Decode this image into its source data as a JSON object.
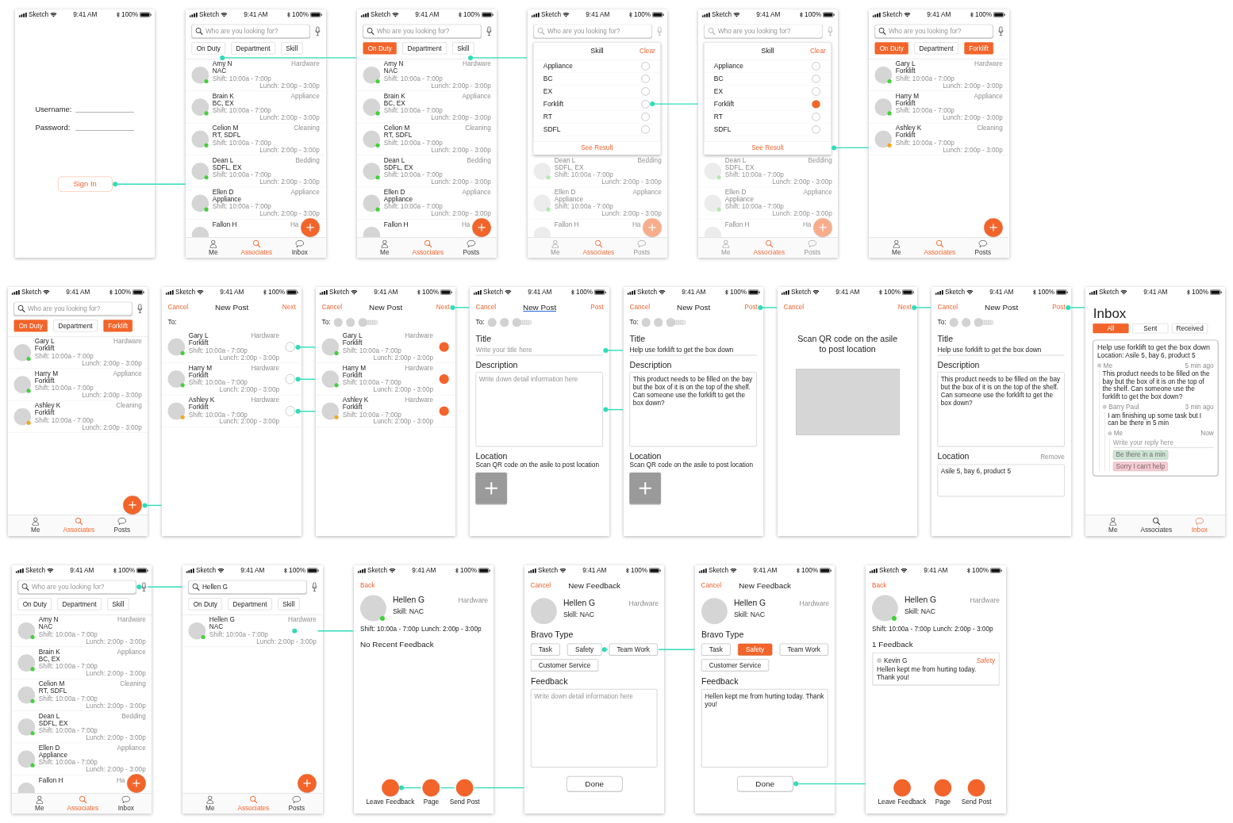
{
  "rows": [
    {
      "screens": [
        {
          "kind": "login",
          "status_bar": {
            "carrier": "Sketch",
            "time": "9:41 AM",
            "battery": "100%"
          },
          "fields": [
            {
              "label": "Username:"
            },
            {
              "label": "Password:"
            }
          ],
          "button": {
            "label": "Sign In",
            "link": true
          }
        },
        {
          "kind": "directory",
          "status_bar": {
            "carrier": "Sketch",
            "time": "9:41 AM",
            "battery": "100%"
          },
          "search": {
            "placeholder": "Who are you looking for?"
          },
          "chips": [
            {
              "label": "On Duty",
              "selected": false,
              "link": true
            },
            {
              "label": "Department",
              "selected": false,
              "link": false
            },
            {
              "label": "Skill",
              "selected": false,
              "link": false
            }
          ],
          "rows": [
            {
              "name": "Amy N",
              "skills": "NAC",
              "department": "Hardware",
              "shift": "Shift: 10:00a - 7:00p",
              "lunch": "Lunch: 2:00p - 3:00p",
              "color": "#43d13b"
            },
            {
              "name": "Brain K",
              "skills": "BC, EX",
              "department": "Appliance",
              "shift": "Shift: 10:00a - 7:00p",
              "lunch": "Lunch: 2:00p - 3:00p",
              "color": "#43d13b"
            },
            {
              "name": "Celion M",
              "skills": "RT, SDFL",
              "department": "Cleaning",
              "shift": "Shift: 10:00a - 7:00p",
              "lunch": "Lunch: 2:00p - 3:00p",
              "color": "#43d13b"
            },
            {
              "name": "Dean L",
              "skills": "SDFL, EX",
              "department": "Bedding",
              "shift": "Shift: 10:00a - 7:00p",
              "lunch": "Lunch: 2:00p - 3:00p",
              "color": "#43d13b"
            },
            {
              "name": "Ellen D",
              "skills": "Appliance",
              "department": "Appliance",
              "shift": "Shift: 10:00a - 7:00p",
              "lunch": "Lunch: 2:00p - 3:00p",
              "color": "#43d13b"
            },
            {
              "name": "Fallon H",
              "department": "Ha"
            }
          ],
          "fab": {
            "link": false
          },
          "tabs": [
            {
              "label": "Me",
              "selected": false
            },
            {
              "label": "Associates",
              "selected": true
            },
            {
              "label": "Inbox",
              "selected": false
            }
          ]
        },
        {
          "kind": "directory",
          "status_bar": {
            "carrier": "Sketch",
            "time": "9:41 AM",
            "battery": "100%"
          },
          "search": {
            "placeholder": "Who are you looking for?"
          },
          "chips": [
            {
              "label": "On Duty",
              "selected": true,
              "link": false
            },
            {
              "label": "Department",
              "selected": false,
              "link": false
            },
            {
              "label": "Skill",
              "selected": false,
              "link": true
            }
          ],
          "rows": [
            {
              "name": "Amy N",
              "skills": "NAC",
              "department": "Hardware",
              "shift": "Shift: 10:00a - 7:00p",
              "lunch": "Lunch: 2:00p - 3:00p",
              "color": "#43d13b"
            },
            {
              "name": "Brain K",
              "skills": "BC, EX",
              "department": "Appliance",
              "shift": "Shift: 10:00a - 7:00p",
              "lunch": "Lunch: 2:00p - 3:00p",
              "color": "#43d13b"
            },
            {
              "name": "Celion M",
              "skills": "RT, SDFL",
              "department": "Cleaning",
              "shift": "Shift: 10:00a - 7:00p",
              "lunch": "Lunch: 2:00p - 3:00p",
              "color": "#43d13b"
            },
            {
              "name": "Dean L",
              "skills": "SDFL, EX",
              "department": "Bedding",
              "shift": "Shift: 10:00a - 7:00p",
              "lunch": "Lunch: 2:00p - 3:00p",
              "color": "#43d13b"
            },
            {
              "name": "Ellen D",
              "skills": "Appliance",
              "department": "Appliance",
              "shift": "Shift: 10:00a - 7:00p",
              "lunch": "Lunch: 2:00p - 3:00p",
              "color": "#43d13b"
            },
            {
              "name": "Fallon H",
              "department": "Ha"
            }
          ],
          "fab": {
            "link": false
          },
          "tabs": [
            {
              "label": "Me",
              "selected": false
            },
            {
              "label": "Associates",
              "selected": true
            },
            {
              "label": "Posts",
              "selected": false
            }
          ]
        },
        {
          "kind": "skill_filter",
          "status_bar": {
            "carrier": "Sketch",
            "time": "9:41 AM",
            "battery": "100%"
          },
          "search": {
            "placeholder": "Who are you looking for?"
          },
          "popup": {
            "title": "Skill",
            "clear": "Clear",
            "options": [
              {
                "label": "Appliance",
                "selected": false,
                "link": false
              },
              {
                "label": "BC",
                "selected": false,
                "link": false
              },
              {
                "label": "EX",
                "selected": false,
                "link": false
              },
              {
                "label": "Forklift",
                "selected": false,
                "link": true
              },
              {
                "label": "RT",
                "selected": false,
                "link": false
              },
              {
                "label": "SDFL",
                "selected": false,
                "link": false
              }
            ],
            "button": {
              "label": "See Result",
              "link": false
            }
          },
          "rows": [
            {
              "name": "Dean L",
              "skills": "SDFL, EX",
              "department": "Bedding",
              "shift": "Shift: 10:00a - 7:00p",
              "lunch": "Lunch: 2:00p - 3:00p",
              "color": "#b2e9ad"
            },
            {
              "name": "Ellen D",
              "skills": "Appliance",
              "department": "Appliance",
              "shift": "Shift: 10:00a - 7:00p",
              "lunch": "Lunch: 2:00p - 3:00p",
              "color": "#b2e9ad"
            },
            {
              "name": "Fallon H",
              "department": "Ha"
            }
          ],
          "fab": {
            "link": false
          },
          "tabs": [
            {
              "label": "Me",
              "selected": false
            },
            {
              "label": "Associates",
              "selected": true
            },
            {
              "label": "Posts",
              "selected": false
            }
          ]
        },
        {
          "kind": "skill_filter",
          "status_bar": {
            "carrier": "Sketch",
            "time": "9:41 AM",
            "battery": "100%"
          },
          "search": {
            "placeholder": "Who are you looking for?"
          },
          "popup": {
            "title": "Skill",
            "clear": "Clear",
            "options": [
              {
                "label": "Appliance",
                "selected": false,
                "link": false
              },
              {
                "label": "BC",
                "selected": false,
                "link": false
              },
              {
                "label": "EX",
                "selected": false,
                "link": false
              },
              {
                "label": "Forklift",
                "selected": true,
                "link": false
              },
              {
                "label": "RT",
                "selected": false,
                "link": false
              },
              {
                "label": "SDFL",
                "selected": false,
                "link": false
              }
            ],
            "button": {
              "label": "See Result",
              "link": true
            }
          },
          "rows": [
            {
              "name": "Dean L",
              "skills": "SDFL, EX",
              "department": "Bedding",
              "shift": "Shift: 10:00a - 7:00p",
              "lunch": "Lunch: 2:00p - 3:00p",
              "color": "#b2e9ad"
            },
            {
              "name": "Ellen D",
              "skills": "Appliance",
              "department": "Appliance",
              "shift": "Shift: 10:00a - 7:00p",
              "lunch": "Lunch: 2:00p - 3:00p",
              "color": "#b2e9ad"
            },
            {
              "name": "Fallon H",
              "department": "Ha"
            }
          ],
          "fab": {
            "link": false
          },
          "tabs": [
            {
              "label": "Me",
              "selected": false
            },
            {
              "label": "Associates",
              "selected": true
            },
            {
              "label": "Posts",
              "selected": false
            }
          ]
        },
        {
          "kind": "directory",
          "status_bar": {
            "carrier": "Sketch",
            "time": "9:41 AM",
            "battery": "100%"
          },
          "search": {
            "placeholder": "Who are you looking for?"
          },
          "chips": [
            {
              "label": "On Duty",
              "selected": true
            },
            {
              "label": "Department",
              "selected": false
            },
            {
              "label": "Forklift",
              "selected": true
            }
          ],
          "rows": [
            {
              "name": "Gary L",
              "skills": "Forklift",
              "department": "Hardware",
              "shift": "Shift: 10:00a - 7:00p",
              "lunch": "Lunch: 2:00p - 3:00p",
              "color": "#43d13b"
            },
            {
              "name": "Harry M",
              "skills": "Forklift",
              "department": "Appliance",
              "shift": "Shift: 10:00a - 7:00p",
              "lunch": "Lunch: 2:00p - 3:00p",
              "color": "#43d13b"
            },
            {
              "name": "Ashley K",
              "skills": "Forklift",
              "department": "Cleaning",
              "shift": "Shift: 10:00a - 7:00p",
              "lunch": "Lunch: 2:00p - 3:00p",
              "color": "#f5a623"
            }
          ],
          "fab": {
            "link": false
          },
          "tabs": [
            {
              "label": "Me",
              "selected": false
            },
            {
              "label": "Associates",
              "selected": true
            },
            {
              "label": "Posts",
              "selected": false
            }
          ]
        }
      ]
    },
    {
      "screens": [
        {
          "kind": "directory",
          "status_bar": {
            "carrier": "Sketch",
            "time": "9:41 AM",
            "battery": "100%"
          },
          "search": {
            "placeholder": "Who are you looking for?"
          },
          "chips": [
            {
              "label": "On Duty",
              "selected": true
            },
            {
              "label": "Department",
              "selected": false
            },
            {
              "label": "Forklift",
              "selected": true
            }
          ],
          "rows": [
            {
              "name": "Gary L",
              "skills": "Forklift",
              "department": "Hardware",
              "shift": "Shift: 10:00a - 7:00p",
              "lunch": "Lunch: 2:00p - 3:00p",
              "color": "#43d13b"
            },
            {
              "name": "Harry M",
              "skills": "Forklift",
              "department": "Appliance",
              "shift": "Shift: 10:00a - 7:00p",
              "lunch": "Lunch: 2:00p - 3:00p",
              "color": "#43d13b"
            },
            {
              "name": "Ashley K",
              "skills": "Forklift",
              "department": "Cleaning",
              "shift": "Shift: 10:00a - 7:00p",
              "lunch": "Lunch: 2:00p - 3:00p",
              "color": "#f5a623"
            }
          ],
          "fab": {
            "link": true
          },
          "tabs": [
            {
              "label": "Me",
              "selected": false
            },
            {
              "label": "Associates",
              "selected": true
            },
            {
              "label": "Posts",
              "selected": false
            }
          ]
        },
        {
          "kind": "pick_recipients",
          "status_bar": {
            "carrier": "Sketch",
            "time": "9:41 AM",
            "battery": "100%"
          },
          "nav": {
            "left": "Cancel",
            "title": "New Post",
            "right": "Next",
            "right_link": false
          },
          "to": {
            "label": "To:"
          },
          "rows": [
            {
              "name": "Gary L",
              "skills": "Forklift",
              "department": "Hardware",
              "shift": "Shift: 10:00a - 7:00p",
              "lunch": "Lunch: 2:00p - 3:00p",
              "color": "#43d13b",
              "selected": false,
              "link": true
            },
            {
              "name": "Harry M",
              "skills": "Forklift",
              "department": "Hardware",
              "shift": "Shift: 10:00a - 7:00p",
              "lunch": "Lunch: 2:00p - 3:00p",
              "color": "#43d13b",
              "selected": false,
              "link": true
            },
            {
              "name": "Ashley K",
              "skills": "Forklift",
              "department": "Hardware",
              "shift": "Shift: 10:00a - 7:00p",
              "lunch": "Lunch: 2:00p - 3:00p",
              "color": "#f5a623",
              "selected": false,
              "link": true
            }
          ]
        },
        {
          "kind": "pick_recipients",
          "status_bar": {
            "carrier": "Sketch",
            "time": "9:41 AM",
            "battery": "100%"
          },
          "nav": {
            "left": "Cancel",
            "title": "New Post",
            "right": "Next",
            "right_link": true
          },
          "to": {
            "label": "To:",
            "recipients": [
              {
                "kind": "avatar"
              },
              {
                "kind": "avatar"
              },
              {
                "kind": "more"
              }
            ]
          },
          "rows": [
            {
              "name": "Gary L",
              "skills": "Forklift",
              "department": "Hardware",
              "shift": "Shift: 10:00a - 7:00p",
              "lunch": "Lunch: 2:00p - 3:00p",
              "color": "#43d13b",
              "selected": true,
              "link": false
            },
            {
              "name": "Harry M",
              "skills": "Forklift",
              "department": "Hardware",
              "shift": "Shift: 10:00a - 7:00p",
              "lunch": "Lunch: 2:00p - 3:00p",
              "color": "#43d13b",
              "selected": true,
              "link": false
            },
            {
              "name": "Ashley K",
              "skills": "Forklift",
              "department": "Hardware",
              "shift": "Shift: 10:00a - 7:00p",
              "lunch": "Lunch: 2:00p - 3:00p",
              "color": "#f5a623",
              "selected": true,
              "link": false
            }
          ]
        },
        {
          "kind": "post_form",
          "status_bar": {
            "carrier": "Sketch",
            "time": "9:41 AM",
            "battery": "100%"
          },
          "nav": {
            "left": "Cancel",
            "title": "New Post",
            "underlined": true,
            "right": "Post",
            "right_link": false
          },
          "to": {
            "label": "To:",
            "recipients": [
              {
                "kind": "avatar"
              },
              {
                "kind": "avatar"
              },
              {
                "kind": "more"
              }
            ]
          },
          "title_field": {
            "label": "Title",
            "placeholder": "Write your title here",
            "link": true
          },
          "description": {
            "label": "Description",
            "placeholder": "Write down detail information here",
            "link": true
          },
          "location": {
            "label": "Location",
            "hint": "Scan QR code on the asile to post location"
          }
        },
        {
          "kind": "post_form",
          "status_bar": {
            "carrier": "Sketch",
            "time": "9:41 AM",
            "battery": "100%"
          },
          "nav": {
            "left": "Cancel",
            "title": "New Post",
            "right": "Post",
            "right_link": true
          },
          "to": {
            "label": "To:",
            "recipients": [
              {
                "kind": "avatar"
              },
              {
                "kind": "avatar"
              },
              {
                "kind": "more"
              }
            ]
          },
          "title_field": {
            "label": "Title",
            "value": "Help use forklift to get the box down"
          },
          "description": {
            "label": "Description",
            "value": "This product needs to be filled on the bay but the box of it is on the top of the shelf. Can someone use the forklift to get the box down?"
          },
          "location": {
            "label": "Location",
            "hint": "Scan QR code on the asile to post location"
          }
        },
        {
          "kind": "scan",
          "status_bar": {
            "carrier": "Sketch",
            "time": "9:41 AM",
            "battery": "100%"
          },
          "nav": {
            "left": "Cancel",
            "right": "Next",
            "right_link": true
          },
          "instruction": "Scan QR code on the asile to post location"
        },
        {
          "kind": "post_form",
          "status_bar": {
            "carrier": "Sketch",
            "time": "9:41 AM",
            "battery": "100%"
          },
          "nav": {
            "left": "Cancel",
            "title": "New Post",
            "right": "Post",
            "right_link": true
          },
          "to": {
            "label": "To:",
            "recipients": [
              {
                "kind": "avatar"
              },
              {
                "kind": "avatar"
              },
              {
                "kind": "more"
              }
            ]
          },
          "title_field": {
            "label": "Title",
            "value": "Help use forklift to get the box down"
          },
          "description": {
            "label": "Description",
            "value": "This product needs to be filled on the bay but the box of it is on the top of the shelf. Can someone use the forklift to get the box down?"
          },
          "location": {
            "label": "Location",
            "remove": "Remove",
            "value": "Asile 5, bay 6, product 5"
          }
        },
        {
          "kind": "inbox",
          "status_bar": {
            "carrier": "Sketch",
            "time": "9:41 AM",
            "battery": "100%"
          },
          "title": "Inbox",
          "segments": [
            {
              "label": "All",
              "selected": true
            },
            {
              "label": "Sent",
              "selected": false
            },
            {
              "label": "Received",
              "selected": false
            }
          ],
          "card": {
            "title": "Help use forklift to get the box down",
            "location": "Location: Asile 5, bay 6, product 5",
            "thread": {
              "author": "Me",
              "time": "5 min ago",
              "text": "This product needs to be filled on the bay but the box of it is on the top of the shelf. Can someone use the forklift to get the box down?",
              "replies": [
                {
                  "author": "Barry Paul",
                  "time": "3 min ago",
                  "text": "I am finishing up some task but I can be there in 5 min",
                  "replies": [
                    {
                      "author": "Me",
                      "time": "Now",
                      "placeholder": "Write your reply here",
                      "quick_replies": [
                        {
                          "label": "Be there in a min",
                          "color": "#cfe3d5"
                        },
                        {
                          "label": "Sorry I can't help",
                          "color": "#f6cbd3"
                        }
                      ]
                    }
                  ]
                }
              ]
            }
          },
          "tabs": [
            {
              "label": "Me",
              "selected": false
            },
            {
              "label": "Associates",
              "selected": false
            },
            {
              "label": "Inbox",
              "selected": true
            }
          ]
        }
      ]
    },
    {
      "screens": [
        {
          "kind": "directory",
          "status_bar": {
            "carrier": "Sketch",
            "time": "9:41 AM",
            "battery": "100%"
          },
          "search": {
            "placeholder": "Who are you looking for?",
            "link": true
          },
          "chips": [
            {
              "label": "On Duty",
              "selected": false
            },
            {
              "label": "Department",
              "selected": false
            },
            {
              "label": "Skill",
              "selected": false
            }
          ],
          "rows": [
            {
              "name": "Amy N",
              "skills": "NAC",
              "department": "Hardware",
              "shift": "Shift: 10:00a - 7:00p",
              "lunch": "Lunch: 2:00p - 3:00p",
              "color": "#43d13b"
            },
            {
              "name": "Brain K",
              "skills": "BC, EX",
              "department": "Appliance",
              "shift": "Shift: 10:00a - 7:00p",
              "lunch": "Lunch: 2:00p - 3:00p",
              "color": "#43d13b"
            },
            {
              "name": "Celion M",
              "skills": "RT, SDFL",
              "department": "Cleaning",
              "shift": "Shift: 10:00a - 7:00p",
              "lunch": "Lunch: 2:00p - 3:00p",
              "color": "#43d13b"
            },
            {
              "name": "Dean L",
              "skills": "SDFL, EX",
              "department": "Bedding",
              "shift": "Shift: 10:00a - 7:00p",
              "lunch": "Lunch: 2:00p - 3:00p",
              "color": "#43d13b"
            },
            {
              "name": "Ellen D",
              "skills": "Appliance",
              "department": "Appliance",
              "shift": "Shift: 10:00a - 7:00p",
              "lunch": "Lunch: 2:00p - 3:00p",
              "color": "#43d13b"
            },
            {
              "name": "Fallon H",
              "department": "Ha"
            }
          ],
          "fab": {
            "link": false
          },
          "tabs": [
            {
              "label": "Me",
              "selected": false
            },
            {
              "label": "Associates",
              "selected": true
            },
            {
              "label": "Inbox",
              "selected": false
            }
          ]
        },
        {
          "kind": "directory",
          "status_bar": {
            "carrier": "Sketch",
            "time": "9:41 AM",
            "battery": "100%"
          },
          "search": {
            "value": "Hellen G"
          },
          "chips": [
            {
              "label": "On Duty",
              "selected": false
            },
            {
              "label": "Department",
              "selected": false
            },
            {
              "label": "Skill",
              "selected": false
            }
          ],
          "rows": [
            {
              "name": "Hellen G",
              "skills": "NAC",
              "department": "Hardware",
              "shift": "Shift: 10:00a - 7:00p",
              "lunch": "Lunch: 2:00p - 3:00p",
              "color": "#43d13b",
              "link": true
            }
          ],
          "fab": {
            "link": false
          },
          "tabs": [
            {
              "label": "Me",
              "selected": false
            },
            {
              "label": "Associates",
              "selected": true
            },
            {
              "label": "Posts",
              "selected": false
            }
          ]
        },
        {
          "kind": "profile",
          "status_bar": {
            "carrier": "Sketch",
            "time": "9:41 AM",
            "battery": "100%"
          },
          "back": "Back",
          "person": {
            "name": "Hellen G",
            "department": "Hardware",
            "skill": "Skill: NAC",
            "color": "#43d13b"
          },
          "shift": "Shift:  10:00a - 7:00p",
          "lunch": "Lunch:  2:00p - 3:00p",
          "feedback_heading": "No Recent Feedback",
          "actions": [
            {
              "label": "Leave Feedback",
              "link": true
            },
            {
              "label": "Page",
              "link": false
            },
            {
              "label": "Send Post",
              "link": false
            }
          ]
        },
        {
          "kind": "feedback_form",
          "status_bar": {
            "carrier": "Sketch",
            "time": "9:41 AM",
            "battery": "100%"
          },
          "nav": {
            "left": "Cancel",
            "title": "New Feedback"
          },
          "person": {
            "name": "Hellen G",
            "department": "Hardware",
            "skill": "Skill: NAC"
          },
          "bravo_label": "Bravo Type",
          "chips": [
            {
              "label": "Task",
              "selected": false,
              "link": false
            },
            {
              "label": "Safety",
              "selected": false,
              "link": true
            },
            {
              "label": "Team Work",
              "selected": false,
              "link": false
            },
            {
              "label": "Customer Service",
              "selected": false,
              "link": false
            }
          ],
          "feedback": {
            "label": "Feedback",
            "placeholder": "Write down detail information here"
          },
          "done": {
            "label": "Done",
            "link": false
          }
        },
        {
          "kind": "feedback_form",
          "status_bar": {
            "carrier": "Sketch",
            "time": "9:41 AM",
            "battery": "100%"
          },
          "nav": {
            "left": "Cancel",
            "title": "New Feedback"
          },
          "person": {
            "name": "Hellen G",
            "department": "Hardware",
            "skill": "Skill: NAC"
          },
          "bravo_label": "Bravo Type",
          "chips": [
            {
              "label": "Task",
              "selected": false,
              "link": false
            },
            {
              "label": "Safety",
              "selected": true,
              "link": false
            },
            {
              "label": "Team Work",
              "selected": false,
              "link": false
            },
            {
              "label": "Customer Service",
              "selected": false,
              "link": false
            }
          ],
          "feedback": {
            "label": "Feedback",
            "value": "Hellen kept me from hurting today. Thank you!"
          },
          "done": {
            "label": "Done",
            "link": true
          }
        },
        {
          "kind": "profile",
          "status_bar": {
            "carrier": "Sketch",
            "time": "9:41 AM",
            "battery": "100%"
          },
          "back": "Back",
          "person": {
            "name": "Hellen G",
            "department": "Hardware",
            "skill": "Skill: NAC",
            "color": "#43d13b"
          },
          "shift": "Shift:  10:00a - 7:00p",
          "lunch": "Lunch:  2:00p - 3:00p",
          "feedback_heading": "1 Feedback",
          "feedback": [
            {
              "author": "Kevin G",
              "type": "Safety",
              "text": "Hellen kept me from hurting today. Thank you!"
            }
          ],
          "actions": [
            {
              "label": "Leave Feedback",
              "link": false
            },
            {
              "label": "Page",
              "link": false
            },
            {
              "label": "Send Post",
              "link": false
            }
          ]
        }
      ]
    }
  ]
}
